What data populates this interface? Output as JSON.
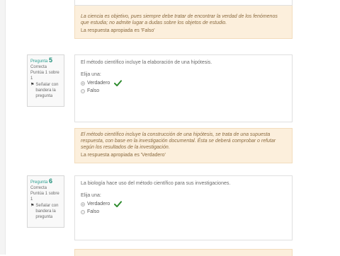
{
  "feedback_prev": {
    "general": "La ciencia es objetivo, pues siempre debe tratar de encontrar la verdad de los fenómenos que estudia; no admite lugar a dudas sobre los objetos de estudio.",
    "right_answer": "La respuesta apropiada es 'Falso'"
  },
  "questions": [
    {
      "label": "Pregunta",
      "number": "5",
      "status": "Correcta",
      "score": "Puntúa 1 sobre 1",
      "flag_label": "Señalar con bandera la pregunta",
      "text": "El método científico incluye la elaboración de una hipótesis.",
      "prompt": "Elija una:",
      "options": [
        {
          "label": "Verdadero",
          "selected": true,
          "correct": true
        },
        {
          "label": "Falso",
          "selected": false,
          "correct": false
        }
      ],
      "feedback": {
        "general": "El método científico incluye la construcción de una hipótesis, se trata de una supuesta respuesta, con base en la investigación documental. Ésta se deberá comprobar o refutar según los resultados de la investigación.",
        "right_answer": "La respuesta apropiada es 'Verdadero'"
      }
    },
    {
      "label": "Pregunta",
      "number": "6",
      "status": "Correcta",
      "score": "Puntúa 1 sobre 1",
      "flag_label": "Señalar con bandera la pregunta",
      "text": "La biología hace uso del método científico para sus investigaciones.",
      "prompt": "Elija una:",
      "options": [
        {
          "label": "Verdadero",
          "selected": true,
          "correct": true
        },
        {
          "label": "Falso",
          "selected": false,
          "correct": false
        }
      ]
    }
  ],
  "icons": {
    "correct": "check-icon",
    "flag": "flag-icon"
  },
  "colors": {
    "feedback_bg": "#fcefdc",
    "correct_check": "#2e8b2e",
    "question_number": "#1f8f7a"
  }
}
